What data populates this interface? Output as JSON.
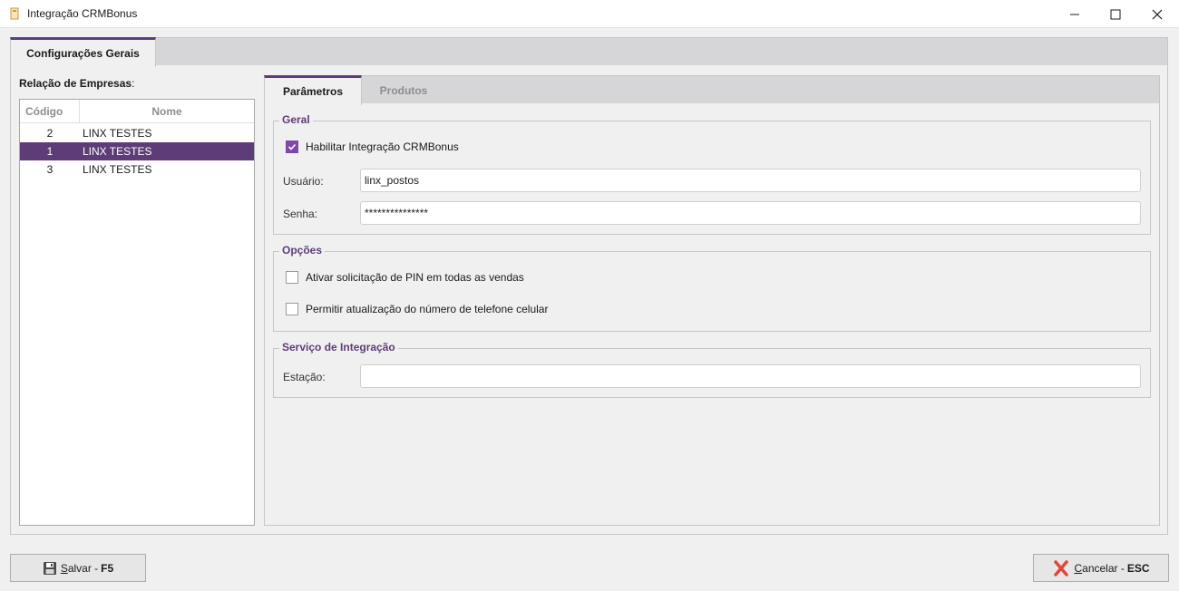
{
  "window": {
    "title": "Integração CRMBonus",
    "icon": "app-icon",
    "controls": [
      "minimize-icon",
      "maximize-icon",
      "close-icon"
    ]
  },
  "outer_tabs": [
    {
      "label": "Configurações Gerais",
      "active": true
    }
  ],
  "companies": {
    "label": "Relação de Empresas",
    "label_suffix": ":",
    "columns": {
      "code": "Código",
      "name": "Nome"
    },
    "rows": [
      {
        "code": "2",
        "name": "LINX TESTES",
        "selected": false
      },
      {
        "code": "1",
        "name": "LINX TESTES",
        "selected": true
      },
      {
        "code": "3",
        "name": "LINX TESTES",
        "selected": false
      }
    ]
  },
  "inner_tabs": [
    {
      "label": "Parâmetros",
      "active": true
    },
    {
      "label": "Produtos",
      "active": false
    }
  ],
  "geral": {
    "title": "Geral",
    "enable_label": "Habilitar Integração CRMBonus",
    "enable_checked": true,
    "user_label": "Usuário:",
    "user_value": "linx_postos",
    "password_label": "Senha:",
    "password_value": "***************"
  },
  "opcoes": {
    "title": "Opções",
    "pin_label": "Ativar solicitação de PIN em todas as vendas",
    "pin_checked": false,
    "phone_label": "Permitir atualização do número de telefone celular",
    "phone_checked": false
  },
  "servico": {
    "title": "Serviço de Integração",
    "station_label": "Estação:",
    "station_value": ""
  },
  "footer": {
    "save_first": "S",
    "save_rest": "alvar -",
    "save_key": "F5",
    "cancel_first": "C",
    "cancel_rest": "ancelar -",
    "cancel_key": "ESC"
  },
  "colors": {
    "accent": "#5e3c78",
    "checkbox": "#7d4ba6",
    "cancel_icon": "#e0463c"
  }
}
